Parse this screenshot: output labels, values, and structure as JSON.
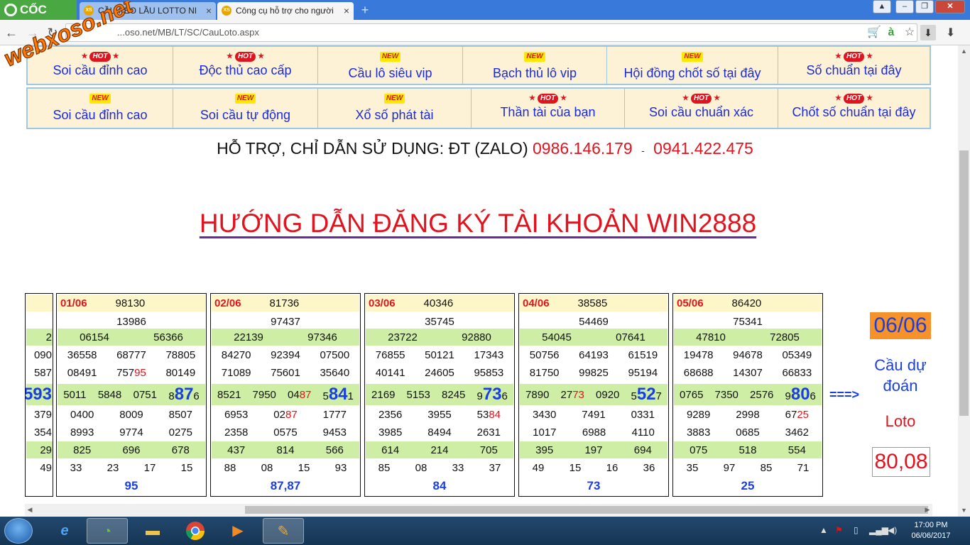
{
  "browser": {
    "brand": "CỐC CỐC",
    "tabs": [
      {
        "label": "CẦU KÈO LẦU LOTTO NI",
        "icon": "XS"
      },
      {
        "label": "Công cụ hỗ trợ cho người",
        "icon": "XS"
      }
    ],
    "url": "...oso.net/MB/LT/SC/CauLoto.aspx",
    "new_tab": "+"
  },
  "watermark": "webxoso.net",
  "menu_row1": [
    {
      "badge": "HOT",
      "label": "Soi cầu đỉnh cao"
    },
    {
      "badge": "HOT",
      "label": "Độc thủ cao cấp"
    },
    {
      "badge": "NEW",
      "label": "Cầu lô siêu vip"
    },
    {
      "badge": "NEW",
      "label": "Bạch thủ lô vip"
    },
    {
      "badge": "NEW",
      "label": "Hội đồng chốt số tại đây"
    },
    {
      "badge": "HOT",
      "label": "Số chuẩn tại đây"
    }
  ],
  "menu_row2": [
    {
      "badge": "NEW",
      "label": "Soi cầu đỉnh cao"
    },
    {
      "badge": "NEW",
      "label": "Soi cầu tự động"
    },
    {
      "badge": "NEW",
      "label": "Xổ số phát tài"
    },
    {
      "badge": "HOT",
      "label": "Thần tài của bạn"
    },
    {
      "badge": "HOT",
      "label": "Soi cầu chuẩn xác"
    },
    {
      "badge": "HOT",
      "label": "Chốt số chuẩn tại đây"
    }
  ],
  "support": {
    "text": "HỖ TRỢ, CHỈ DẪN SỬ DỤNG: ĐT (ZALO)",
    "phone1": "0986.146.179",
    "sep": "-",
    "phone2": "0941.422.475"
  },
  "guide_title": "HƯỚNG DẪN ĐĂNG KÝ TÀI KHOẢN WIN2888",
  "partial_card": [
    "",
    "",
    "2",
    "090",
    "587",
    "593",
    "379",
    "354",
    "29",
    "49"
  ],
  "cards": [
    {
      "date": "01/06",
      "db": "98130",
      "g1": "13986",
      "g2": [
        "06154",
        "56366"
      ],
      "g3a": [
        "36558",
        "68777",
        "78805"
      ],
      "g3b": [
        "08491",
        "75795",
        "80149"
      ],
      "g4": [
        "5011",
        "5848",
        "0751",
        "87",
        "8",
        "6"
      ],
      "g5a": [
        "0400",
        "8009",
        "8507"
      ],
      "g5b": [
        "8993",
        "9774",
        "0275"
      ],
      "g6": [
        "825",
        "696",
        "678"
      ],
      "g7": [
        "33",
        "23",
        "17",
        "15"
      ],
      "result": "95"
    },
    {
      "date": "02/06",
      "db": "81736",
      "g1": "97437",
      "g2": [
        "22139",
        "97346"
      ],
      "g3a": [
        "84270",
        "92394",
        "07500"
      ],
      "g3b": [
        "71089",
        "75601",
        "35640"
      ],
      "g4": [
        "8521",
        "7950",
        "0487",
        "84",
        "5",
        "1"
      ],
      "g5a": [
        "6953",
        "0287",
        "1777"
      ],
      "g5b": [
        "2358",
        "0575",
        "9453"
      ],
      "g6": [
        "437",
        "814",
        "566"
      ],
      "g7": [
        "88",
        "08",
        "15",
        "93"
      ],
      "result": "87,87"
    },
    {
      "date": "03/06",
      "db": "40346",
      "g1": "35745",
      "g2": [
        "23722",
        "92880"
      ],
      "g3a": [
        "76855",
        "50121",
        "17343"
      ],
      "g3b": [
        "40141",
        "24605",
        "95853"
      ],
      "g4": [
        "2169",
        "5153",
        "8245",
        "73",
        "9",
        "6"
      ],
      "g5a": [
        "2356",
        "3955",
        "5384"
      ],
      "g5b": [
        "3985",
        "8494",
        "2631"
      ],
      "g6": [
        "614",
        "214",
        "705"
      ],
      "g7": [
        "85",
        "08",
        "33",
        "37"
      ],
      "result": "84"
    },
    {
      "date": "04/06",
      "db": "38585",
      "g1": "54469",
      "g2": [
        "54045",
        "07641"
      ],
      "g3a": [
        "50756",
        "64193",
        "61519"
      ],
      "g3b": [
        "81750",
        "99825",
        "95194"
      ],
      "g4": [
        "7890",
        "2773",
        "0920",
        "52",
        "5",
        "7"
      ],
      "g5a": [
        "3430",
        "7491",
        "0331"
      ],
      "g5b": [
        "1017",
        "6988",
        "4110"
      ],
      "g6": [
        "395",
        "197",
        "694"
      ],
      "g7": [
        "49",
        "15",
        "16",
        "36"
      ],
      "result": "73"
    },
    {
      "date": "05/06",
      "db": "86420",
      "g1": "75341",
      "g2": [
        "47810",
        "72805"
      ],
      "g3a": [
        "19478",
        "94678",
        "05349"
      ],
      "g3b": [
        "68688",
        "14307",
        "66833"
      ],
      "g4": [
        "0765",
        "7350",
        "2576",
        "80",
        "9",
        "6"
      ],
      "g5a": [
        "9289",
        "2998",
        "6725"
      ],
      "g5b": [
        "3883",
        "0685",
        "3462"
      ],
      "g6": [
        "075",
        "518",
        "554"
      ],
      "g7": [
        "35",
        "97",
        "85",
        "71"
      ],
      "result": "25"
    }
  ],
  "prediction": {
    "arrow": "===>",
    "date": "06/06",
    "title": "Cầu dự đoán",
    "subtitle": "Loto",
    "value": "80,08"
  },
  "taskbar": {
    "time": "17:00 PM",
    "date": "06/06/2017"
  },
  "colors": {
    "red": "#e0141e",
    "blue": "#1a3fe0",
    "menu_bg": "#fdf1d6",
    "green_row": "#cfeea5",
    "yellow_row": "#fdf6c8",
    "orange": "#f7922a"
  }
}
